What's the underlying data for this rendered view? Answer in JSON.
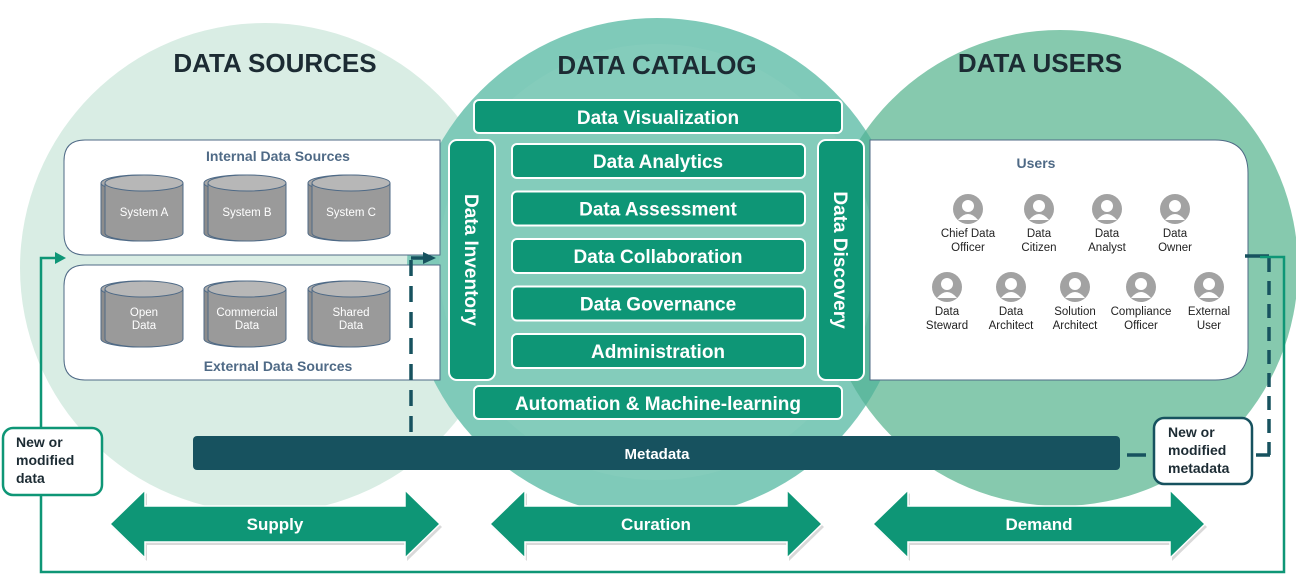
{
  "sections": {
    "sources": {
      "title": "DATA SOURCES"
    },
    "catalog": {
      "title": "DATA CATALOG"
    },
    "users": {
      "title": "DATA USERS"
    }
  },
  "internal_sources": {
    "title": "Internal Data Sources",
    "items": [
      [
        "System A"
      ],
      [
        "System B"
      ],
      [
        "System C"
      ]
    ]
  },
  "external_sources": {
    "title": "External Data Sources",
    "items": [
      [
        "Open",
        "Data"
      ],
      [
        "Commercial",
        "Data"
      ],
      [
        "Shared",
        "Data"
      ]
    ]
  },
  "catalog": {
    "top": "Data Visualization",
    "bottom": "Automation & Machine-learning",
    "left": "Data Inventory",
    "right": "Data Discovery",
    "center": [
      "Data Analytics",
      "Data Assessment",
      "Data Collaboration",
      "Data Governance",
      "Administration"
    ]
  },
  "users": {
    "title": "Users",
    "row1": [
      [
        "Chief Data",
        "Officer"
      ],
      [
        "Data",
        "Citizen"
      ],
      [
        "Data",
        "Analyst"
      ],
      [
        "Data",
        "Owner"
      ]
    ],
    "row2": [
      [
        "Data",
        "Steward"
      ],
      [
        "Data",
        "Architect"
      ],
      [
        "Solution",
        "Architect"
      ],
      [
        "Compliance",
        "Officer"
      ],
      [
        "External",
        "User"
      ]
    ]
  },
  "metadata_bar": {
    "label": "Metadata"
  },
  "notes": {
    "new_data": [
      "New or",
      "modified",
      "data"
    ],
    "new_metadata": [
      "New or",
      "modified",
      "metadata"
    ]
  },
  "flows": [
    {
      "label": "Supply"
    },
    {
      "label": "Curation"
    },
    {
      "label": "Demand"
    }
  ],
  "colors": {
    "circle_sources": "#d9ede4",
    "circle_catalog": "#7fcab9",
    "circle_users": "#86c9ae",
    "box_green": "#0e9676",
    "metadata_dark": "#17525f",
    "loop_line": "#0e9676",
    "heading": "#1c2b33",
    "panel_title": "#4f6a86",
    "db_gray": "#9a9a9a",
    "avatar_gray": "#a2a2a2"
  }
}
